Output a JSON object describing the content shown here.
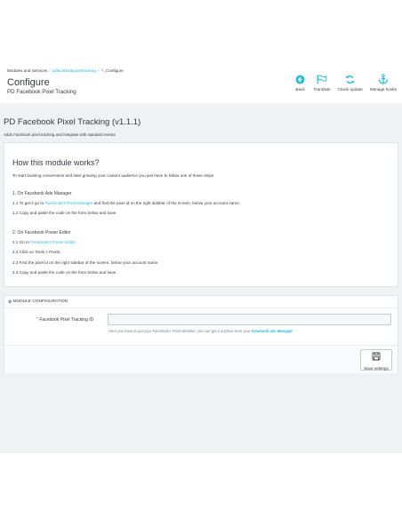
{
  "header": {
    "breadcrumb": [
      "Modules and Services",
      "pdfacebookpixeltracking",
      "Configure"
    ],
    "title": "Configure",
    "subtitle": "PD Facebook Pixel Tracking",
    "toolbar": [
      {
        "label": "Back",
        "icon": "back-arrow-icon"
      },
      {
        "label": "Translate",
        "icon": "flag-icon"
      },
      {
        "label": "Check update",
        "icon": "refresh-icon"
      },
      {
        "label": "Manage hooks",
        "icon": "anchor-icon"
      }
    ]
  },
  "module": {
    "title": "PD Facebook Pixel Tracking (v1.1.1)",
    "description": "Adds Facebook pixel tracking and integrate with standard events"
  },
  "help": {
    "title": "How this module works?",
    "intro": "To start tracking conversions and start growing your custom audience you just have to follow one of those steps",
    "ads_manager": {
      "heading": "1. On Facebook Ads Manager",
      "step1_prefix": "1.1 To get it go to",
      "step1_link": "Facebook's Pixel Manager",
      "step1_suffix": "and find the pixel id on the right sidebar of the screen, below your account name.",
      "step2": "1.2 Copy and paste the code on the form below and save"
    },
    "power_editor": {
      "heading": "2. On Facebook Power Editor",
      "step1_prefix": "2.1 Go to",
      "step1_link": "Facebook's Power Editor",
      "step2": "2.2 Click on Tools > Pixels.",
      "step3": "2.3 Find the pixel id on the right sidebar of the screen, below your account name.",
      "step4": "2.4 Copy and paste the code on the form below and save"
    }
  },
  "config": {
    "heading": "MODULE CONFIGURATION",
    "field_label": "Facebook Pixel Tracking ID",
    "field_required_mark": "*",
    "field_value": "",
    "help_prefix": "Here you have to put your Facebook's Pixel identifier, you can get it anytime from your",
    "help_link": "Facebook ads Manager",
    "save_label": "Save settings"
  },
  "colors": {
    "accent": "#25b9d7",
    "background": "#eff1f2",
    "text": "#363a41"
  }
}
